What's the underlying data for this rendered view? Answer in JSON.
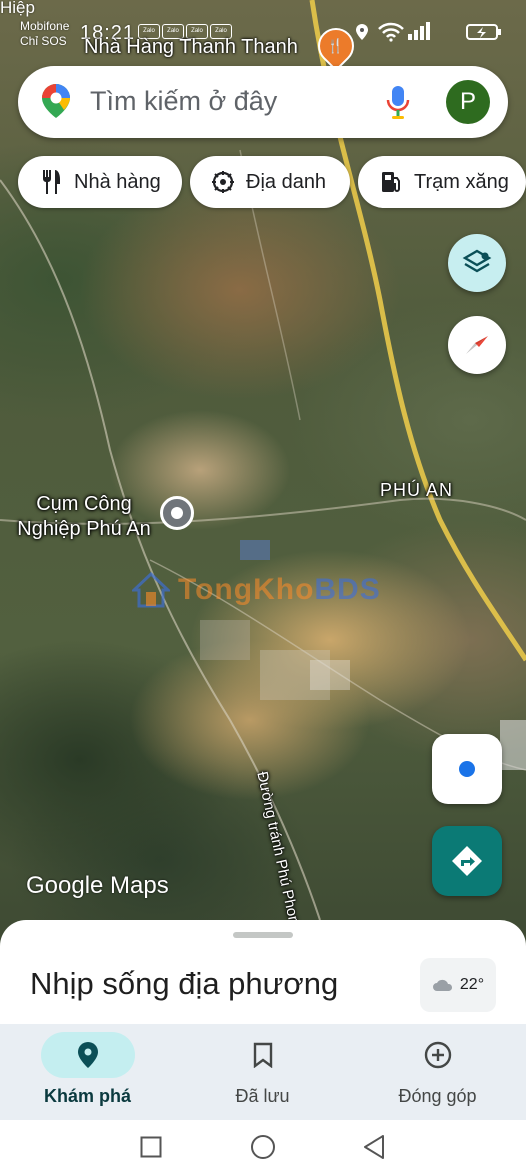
{
  "status_bar": {
    "carrier_top": "Hiệp",
    "carrier": "Mobifone",
    "sos": "Chỉ SOS",
    "time": "18:21",
    "zalo_badges": [
      "Zalo",
      "Zalo",
      "Zalo",
      "Zalo"
    ],
    "icons": [
      "location-icon",
      "alarm-icon",
      "wifi-icon",
      "signal-icon",
      "battery-icon"
    ]
  },
  "map": {
    "top_poi": "Nhà Hàng Thanh Thanh",
    "top_poi_icon": "restaurant-icon",
    "cluster_label": "Cụm Công Nghiệp Phú An",
    "area_label": "PHÚ AN",
    "road_label": "Đường tránh Phú Phong",
    "watermark": "TongKhoBDS",
    "watermark_part1": "TongKho",
    "watermark_part2": "BDS",
    "logo": "Google Maps"
  },
  "search": {
    "placeholder": "Tìm kiếm ở đây",
    "avatar_letter": "P",
    "avatar_color": "#2e6b1f"
  },
  "chips": [
    {
      "label": "Nhà hàng",
      "icon": "fork-knife-icon"
    },
    {
      "label": "Địa danh",
      "icon": "landmark-icon"
    },
    {
      "label": "Trạm xăng",
      "icon": "gas-station-icon"
    }
  ],
  "sheet": {
    "title": "Nhịp sống địa phương",
    "weather": "22°",
    "weather_icon": "cloud-icon"
  },
  "bottom_nav": [
    {
      "label": "Khám phá",
      "icon": "explore-pin-icon",
      "active": true
    },
    {
      "label": "Đã lưu",
      "icon": "bookmark-icon",
      "active": false
    },
    {
      "label": "Đóng góp",
      "icon": "add-circle-icon",
      "active": false
    }
  ],
  "system_nav": [
    "recents-icon",
    "home-icon",
    "back-icon"
  ],
  "colors": {
    "accent": "#1a73e8",
    "nav_active": "#c4eef0",
    "directions": "#0b7a75"
  }
}
